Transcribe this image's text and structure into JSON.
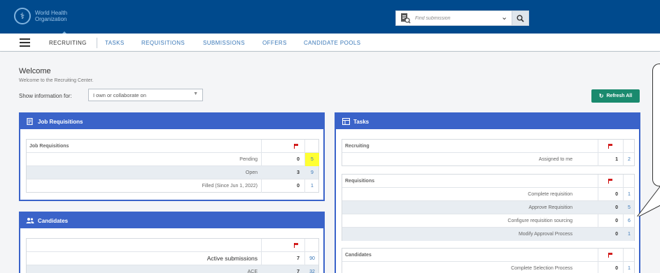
{
  "header": {
    "org_line1": "World Health",
    "org_line2": "Organization",
    "search": {
      "placeholder": "Find submission"
    }
  },
  "nav": {
    "tabs": [
      {
        "label": "RECRUITING",
        "active": true
      },
      {
        "label": "TASKS"
      },
      {
        "label": "REQUISITIONS"
      },
      {
        "label": "SUBMISSIONS"
      },
      {
        "label": "OFFERS"
      },
      {
        "label": "CANDIDATE POOLS"
      }
    ]
  },
  "welcome": {
    "title": "Welcome",
    "subtitle": "Welcome to the Recruiting Center.",
    "show_label": "Show information for:",
    "show_value": "I own or collaborate on",
    "refresh_label": "Refresh All"
  },
  "job_requisitions": {
    "title": "Job Requisitions",
    "section": "Job Requisitions",
    "rows": [
      {
        "label": "Pending",
        "count": "0",
        "link": "5"
      },
      {
        "label": "Open",
        "count": "3",
        "link": "9"
      },
      {
        "label": "Filled (Since Jun 1, 2022)",
        "count": "0",
        "link": "1"
      }
    ]
  },
  "candidates": {
    "title": "Candidates",
    "rows": [
      {
        "label": "Active submissions",
        "count": "7",
        "link": "90"
      },
      {
        "label": "ACE",
        "count": "7",
        "link": "32"
      }
    ]
  },
  "tasks": {
    "title": "Tasks",
    "recruiting": {
      "section": "Recruiting",
      "rows": [
        {
          "label": "Assigned to me",
          "count": "1",
          "link": "2"
        }
      ]
    },
    "requisitions": {
      "section": "Requisitions",
      "rows": [
        {
          "label": "Complete requisition",
          "count": "0",
          "link": "1"
        },
        {
          "label": "Approve Requisition",
          "count": "0",
          "link": "5"
        },
        {
          "label": "Configure requisition sourcing",
          "count": "0",
          "link": "6"
        },
        {
          "label": "Modify Approval Process",
          "count": "0",
          "link": "1"
        }
      ]
    },
    "candidates": {
      "section": "Candidates",
      "rows": [
        {
          "label": "Complete Selection Process",
          "count": "0",
          "link": "1"
        }
      ]
    }
  },
  "colors": {
    "header_bg": "#004a8d",
    "panel_blue": "#3a63c9",
    "refresh_green": "#1a8a6e",
    "link_blue": "#3a78b8",
    "flag_red": "#d32020",
    "highlight_yellow": "#ffff33"
  }
}
